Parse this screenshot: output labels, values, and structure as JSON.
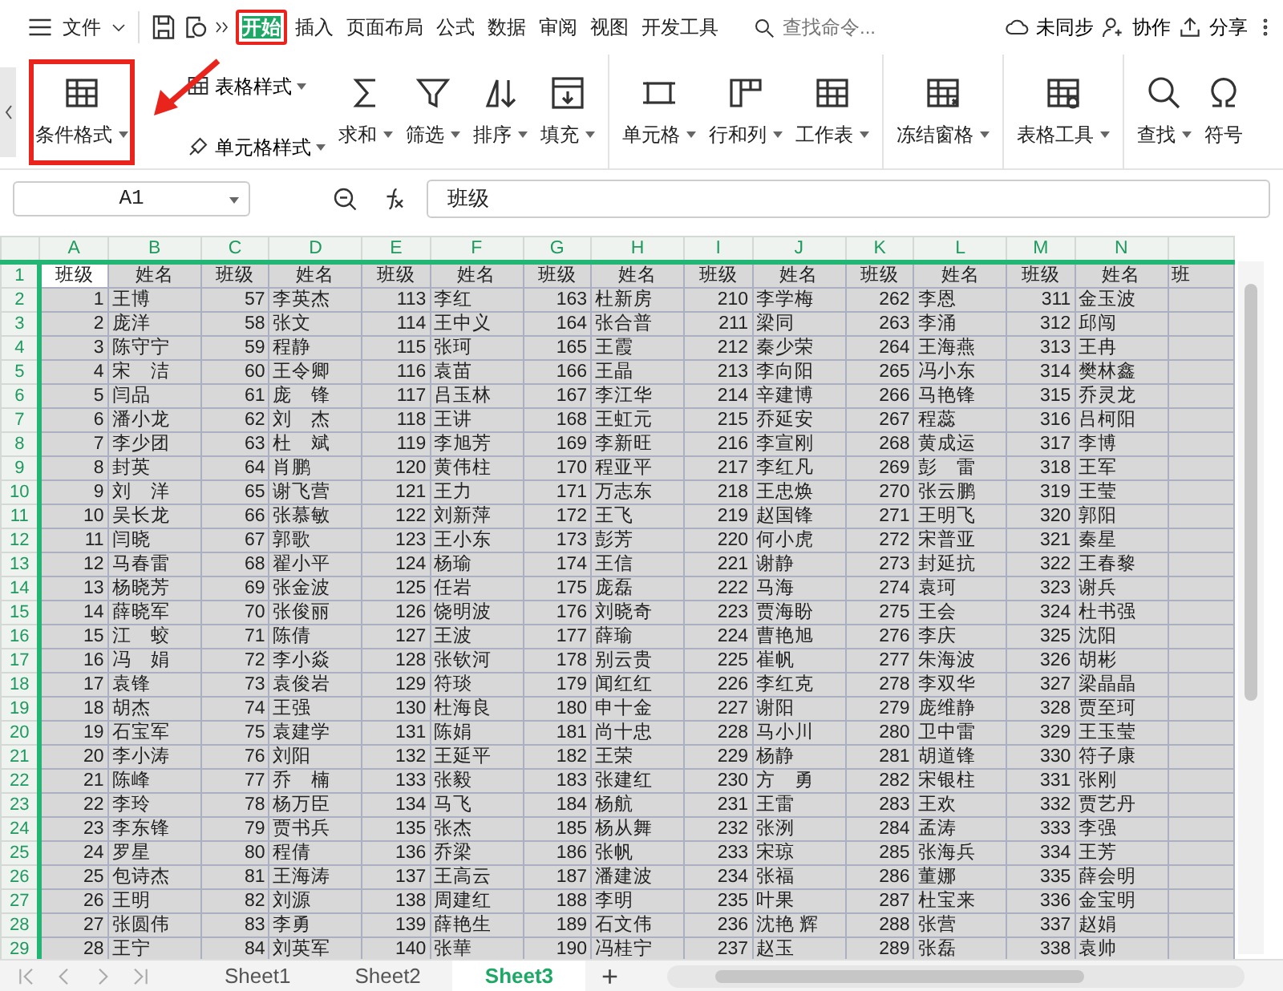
{
  "menu_bar": {
    "file_menu": "文件",
    "tabs": [
      {
        "label": "开始",
        "selected": true,
        "highlighted": true
      },
      {
        "label": "插入",
        "selected": false,
        "highlighted": false
      },
      {
        "label": "页面布局",
        "selected": false,
        "highlighted": false
      },
      {
        "label": "公式",
        "selected": false,
        "highlighted": false
      },
      {
        "label": "数据",
        "selected": false,
        "highlighted": false
      },
      {
        "label": "审阅",
        "selected": false,
        "highlighted": false
      },
      {
        "label": "视图",
        "selected": false,
        "highlighted": false
      },
      {
        "label": "开发工具",
        "selected": false,
        "highlighted": false
      }
    ],
    "search": {
      "placeholder": "查找命令..."
    },
    "actions": [
      "未同步",
      "协作",
      "分享"
    ]
  },
  "ribbon": {
    "groups": [
      [
        {
          "label": "条件格式",
          "kind": "large",
          "dropdown": true,
          "highlighted": true
        },
        {
          "label": "表格样式",
          "kind": "small",
          "dropdown": true,
          "highlighted": false
        },
        {
          "label": "单元格样式",
          "kind": "small",
          "dropdown": true,
          "highlighted": false
        },
        {
          "label": "求和",
          "kind": "large",
          "dropdown": true,
          "highlighted": false
        },
        {
          "label": "筛选",
          "kind": "large",
          "dropdown": true,
          "highlighted": false
        },
        {
          "label": "排序",
          "kind": "large",
          "dropdown": true,
          "highlighted": false
        },
        {
          "label": "填充",
          "kind": "large",
          "dropdown": true,
          "highlighted": false
        }
      ],
      [
        {
          "label": "单元格",
          "kind": "large",
          "dropdown": true,
          "highlighted": false
        },
        {
          "label": "行和列",
          "kind": "large",
          "dropdown": true,
          "highlighted": false
        },
        {
          "label": "工作表",
          "kind": "large",
          "dropdown": true,
          "highlighted": false
        }
      ],
      [
        {
          "label": "冻结窗格",
          "kind": "large",
          "dropdown": true,
          "highlighted": false
        }
      ],
      [
        {
          "label": "表格工具",
          "kind": "large",
          "dropdown": true,
          "highlighted": false
        }
      ],
      [
        {
          "label": "查找",
          "kind": "large",
          "dropdown": true,
          "highlighted": false
        },
        {
          "label": "符号",
          "kind": "cut",
          "dropdown": false,
          "highlighted": false
        }
      ]
    ]
  },
  "arrow": true,
  "formula_bar": {
    "cell_ref": "A1",
    "content": "班级"
  },
  "sheet": {
    "row_numbers": [
      "1",
      "2",
      "3",
      "4",
      "5",
      "6",
      "7",
      "8",
      "9",
      "10",
      "11",
      "12",
      "13",
      "14",
      "15",
      "16",
      "17",
      "18",
      "19",
      "20",
      "21",
      "22",
      "23",
      "24",
      "25",
      "26",
      "27",
      "28",
      "29"
    ],
    "column_letters": [
      "A",
      "B",
      "C",
      "D",
      "E",
      "F",
      "G",
      "H",
      "I",
      "J",
      "K",
      "L",
      "M",
      "N"
    ],
    "header_row": [
      "班级",
      "姓名",
      "班级",
      "姓名",
      "班级",
      "姓名",
      "班级",
      "姓名",
      "班级",
      "姓名",
      "班级",
      "姓名",
      "班级",
      "姓名",
      "班"
    ],
    "rows": [
      [
        "1",
        "王博",
        "57",
        "李英杰",
        "113",
        "李红",
        "163",
        "杜新房",
        "210",
        "李学梅",
        "262",
        "李恩",
        "311",
        "金玉波"
      ],
      [
        "2",
        "庞洋",
        "58",
        "张文",
        "114",
        "王中义",
        "164",
        "张合普",
        "211",
        "梁同",
        "263",
        "李涌",
        "312",
        "邱闯"
      ],
      [
        "3",
        "陈守宁",
        "59",
        "程静",
        "115",
        "张珂",
        "165",
        "王霞",
        "212",
        "秦少荣",
        "264",
        "王海燕",
        "313",
        "王冉"
      ],
      [
        "4",
        "宋　洁",
        "60",
        "王令卿",
        "116",
        "袁苗",
        "166",
        "王晶",
        "213",
        "李向阳",
        "265",
        "冯小东",
        "314",
        "樊林鑫"
      ],
      [
        "5",
        "闫品",
        "61",
        "庞　锋",
        "117",
        "吕玉林",
        "167",
        "李江华",
        "214",
        "辛建博",
        "266",
        "马艳锋",
        "315",
        "乔灵龙"
      ],
      [
        "6",
        "潘小龙",
        "62",
        "刘　杰",
        "118",
        "王讲",
        "168",
        "王虹元",
        "215",
        "乔延安",
        "267",
        "程蕊",
        "316",
        "吕柯阳"
      ],
      [
        "7",
        "李少团",
        "63",
        "杜　斌",
        "119",
        "李旭芳",
        "169",
        "李新旺",
        "216",
        "李宣刚",
        "268",
        "黄成运",
        "317",
        "李博"
      ],
      [
        "8",
        "封英",
        "64",
        "肖鹏",
        "120",
        "黄伟柱",
        "170",
        "程亚平",
        "217",
        "李红凡",
        "269",
        "彭　雷",
        "318",
        "王军"
      ],
      [
        "9",
        "刘　洋",
        "65",
        "谢飞营",
        "121",
        "王力",
        "171",
        "万志东",
        "218",
        "王忠焕",
        "270",
        "张云鹏",
        "319",
        "王莹"
      ],
      [
        "10",
        "吴长龙",
        "66",
        "张慕敏",
        "122",
        "刘新萍",
        "172",
        "王飞",
        "219",
        "赵国锋",
        "271",
        "王明飞",
        "320",
        "郭阳"
      ],
      [
        "11",
        "闫晓",
        "67",
        "郭歌",
        "123",
        "王小东",
        "173",
        "彭芳",
        "220",
        "何小虎",
        "272",
        "宋普亚",
        "321",
        "秦星"
      ],
      [
        "12",
        "马春雷",
        "68",
        "翟小平",
        "124",
        "杨瑜",
        "174",
        "王信",
        "221",
        "谢静",
        "273",
        "封延抗",
        "322",
        "王春黎"
      ],
      [
        "13",
        "杨晓芳",
        "69",
        "张金波",
        "125",
        "任岩",
        "175",
        "庞磊",
        "222",
        "马海",
        "274",
        "袁珂",
        "323",
        "谢兵"
      ],
      [
        "14",
        "薛晓军",
        "70",
        "张俊丽",
        "126",
        "饶明波",
        "176",
        "刘晓奇",
        "223",
        "贾海盼",
        "275",
        "王会",
        "324",
        "杜书强"
      ],
      [
        "15",
        "江　蛟",
        "71",
        "陈倩",
        "127",
        "王波",
        "177",
        "薛瑜",
        "224",
        "曹艳旭",
        "276",
        "李庆",
        "325",
        "沈阳"
      ],
      [
        "16",
        "冯　娟",
        "72",
        "李小焱",
        "128",
        "张钦河",
        "178",
        "别云贵",
        "225",
        "崔帆",
        "277",
        "朱海波",
        "326",
        "胡彬"
      ],
      [
        "17",
        "袁锋",
        "73",
        "袁俊岩",
        "129",
        "符琰",
        "179",
        "闻红红",
        "226",
        "李红克",
        "278",
        "李双华",
        "327",
        "梁晶晶"
      ],
      [
        "18",
        "胡杰",
        "74",
        "王强",
        "130",
        "杜海良",
        "180",
        "申十金",
        "227",
        "谢阳",
        "279",
        "庞维静",
        "328",
        "贾至珂"
      ],
      [
        "19",
        "石宝军",
        "75",
        "袁建学",
        "131",
        "陈娟",
        "181",
        "尚十忠",
        "228",
        "马小川",
        "280",
        "卫中雷",
        "329",
        "王玉莹"
      ],
      [
        "20",
        "李小涛",
        "76",
        "刘阳",
        "132",
        "王延平",
        "182",
        "王荣",
        "229",
        "杨静",
        "281",
        "胡道锋",
        "330",
        "符子康"
      ],
      [
        "21",
        "陈峰",
        "77",
        "乔　楠",
        "133",
        "张毅",
        "183",
        "张建红",
        "230",
        "方　勇",
        "282",
        "宋银柱",
        "331",
        "张刚"
      ],
      [
        "22",
        "李玲",
        "78",
        "杨万臣",
        "134",
        "马飞",
        "184",
        "杨航",
        "231",
        "王雷",
        "283",
        "王欢",
        "332",
        "贾艺丹"
      ],
      [
        "23",
        "李东锋",
        "79",
        "贾书兵",
        "135",
        "张杰",
        "185",
        "杨从舞",
        "232",
        "张洌",
        "284",
        "孟涛",
        "333",
        "李强"
      ],
      [
        "24",
        "罗星",
        "80",
        "程倩",
        "136",
        "乔梁",
        "186",
        "张帆",
        "233",
        "宋琼",
        "285",
        "张海兵",
        "334",
        "王芳"
      ],
      [
        "25",
        "包诗杰",
        "81",
        "王海涛",
        "137",
        "王高云",
        "187",
        "潘建波",
        "234",
        "张福",
        "286",
        "董娜",
        "335",
        "薛会明"
      ],
      [
        "26",
        "王明",
        "82",
        "刘源",
        "138",
        "周建红",
        "188",
        "李明",
        "235",
        "叶果",
        "287",
        "杜宝来",
        "336",
        "金宝明"
      ],
      [
        "27",
        "张圆伟",
        "83",
        "李勇",
        "139",
        "薛艳生",
        "189",
        "石文伟",
        "236",
        "沈艳 辉",
        "288",
        "张营",
        "337",
        "赵娟"
      ],
      [
        "28",
        "王宁",
        "84",
        "刘英军",
        "140",
        "张華",
        "190",
        "冯桂宁",
        "237",
        "赵玉",
        "289",
        "张磊",
        "338",
        "袁帅"
      ]
    ]
  },
  "sheet_tabs": [
    {
      "label": "Sheet1",
      "selected": false
    },
    {
      "label": "Sheet2",
      "selected": false
    },
    {
      "label": "Sheet3",
      "selected": true
    }
  ],
  "add_sheet": "+"
}
